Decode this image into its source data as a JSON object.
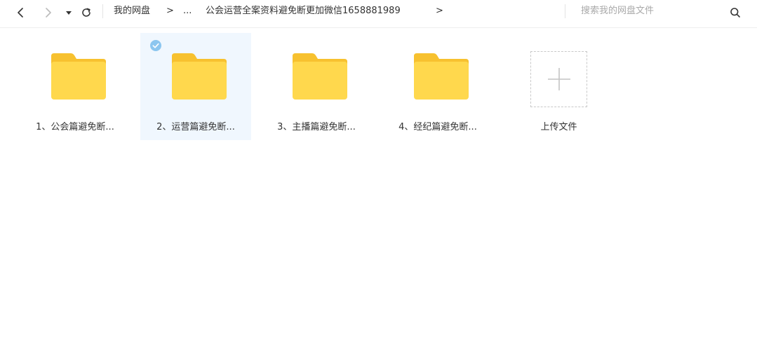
{
  "breadcrumb": {
    "root": "我的网盘",
    "sep": ">",
    "ellipsis": "...",
    "current": "公会运营全案资料避免断更加微信1658881989",
    "trailing_sep": ">"
  },
  "search": {
    "placeholder": "搜索我的网盘文件"
  },
  "files": [
    {
      "label": "1、公会篇避免断...",
      "selected": false
    },
    {
      "label": "2、运营篇避免断...",
      "selected": true
    },
    {
      "label": "3、主播篇避免断...",
      "selected": false
    },
    {
      "label": "4、经纪篇避免断...",
      "selected": false
    }
  ],
  "upload": {
    "label": "上传文件"
  },
  "colors": {
    "folder_back": "#f7c12f",
    "folder_front": "#ffd84d",
    "selection_bg": "#f0f7fe",
    "check": "#8cc6ef"
  }
}
